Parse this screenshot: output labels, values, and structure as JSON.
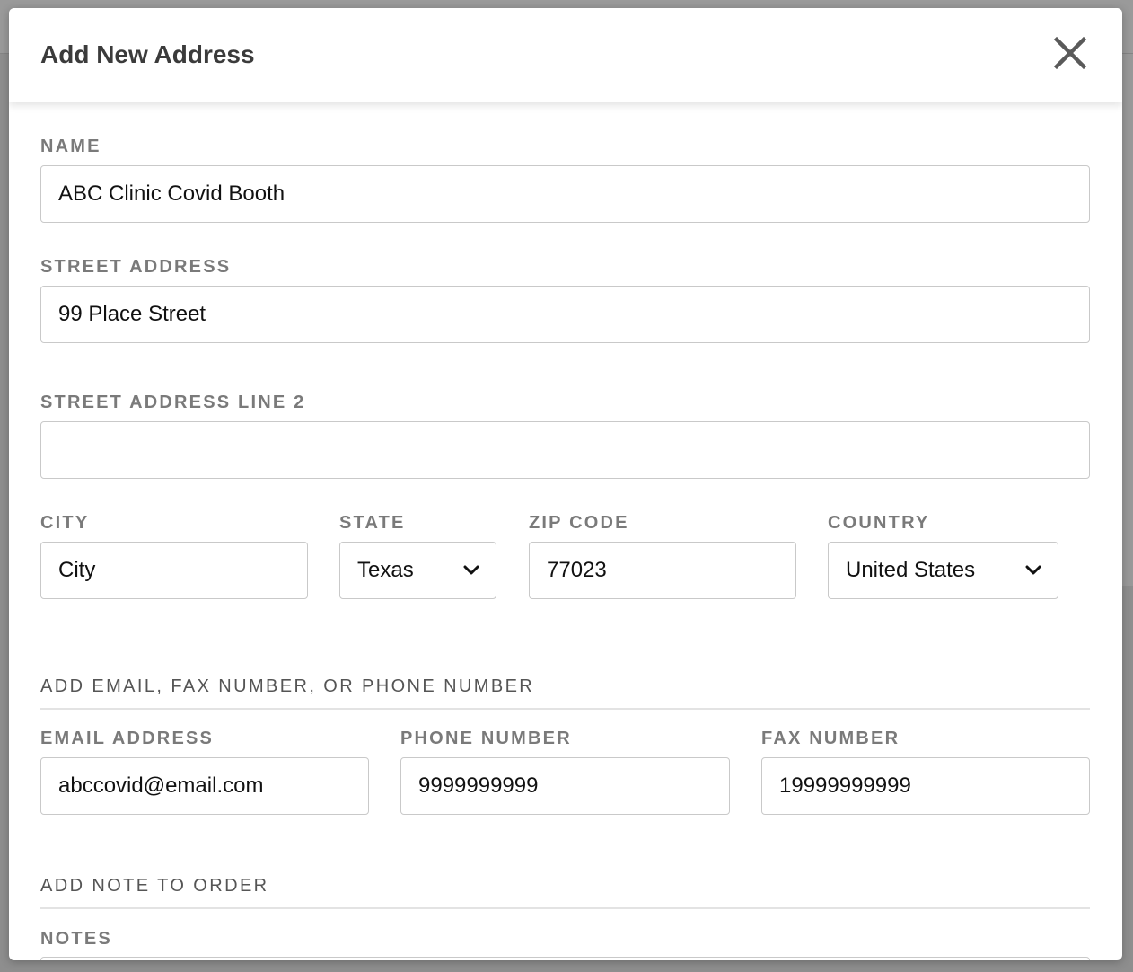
{
  "modal": {
    "title": "Add New Address"
  },
  "form": {
    "name": {
      "label": "NAME",
      "value": "ABC Clinic Covid Booth"
    },
    "street": {
      "label": "STREET ADDRESS",
      "value": "99 Place Street"
    },
    "street2": {
      "label": "STREET ADDRESS LINE 2",
      "value": ""
    },
    "city": {
      "label": "CITY",
      "value": "City"
    },
    "state": {
      "label": "STATE",
      "value": "Texas"
    },
    "zip": {
      "label": "ZIP CODE",
      "value": "77023"
    },
    "country": {
      "label": "COUNTRY",
      "value": "United States"
    }
  },
  "contact": {
    "section_label": "ADD EMAIL, FAX NUMBER, OR PHONE NUMBER",
    "email": {
      "label": "EMAIL ADDRESS",
      "value": "abccovid@email.com"
    },
    "phone": {
      "label": "PHONE NUMBER",
      "value": "9999999999"
    },
    "fax": {
      "label": "FAX NUMBER",
      "value": "19999999999"
    }
  },
  "notes": {
    "section_label": "ADD NOTE TO ORDER",
    "label": "NOTES"
  },
  "icons": {
    "close": "close-icon",
    "state_dropdown": "chevron-down-icon",
    "country_dropdown": "chevron-down-icon"
  },
  "colors": {
    "label": "#7a7a7a",
    "title": "#3b3b3b",
    "border": "#c9c9c9",
    "overlay": "#8f8f8f"
  }
}
